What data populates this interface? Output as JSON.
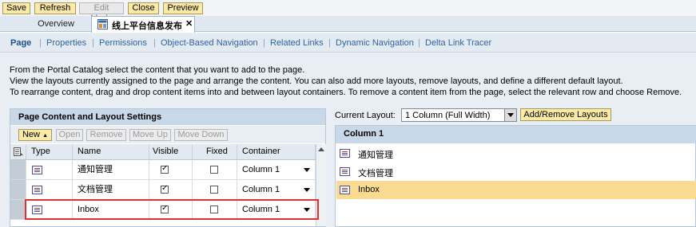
{
  "toolbar": {
    "buttons": [
      {
        "label": "Save",
        "enabled": true
      },
      {
        "label": "Refresh",
        "enabled": true
      },
      {
        "label": "Edit Mode",
        "enabled": false
      },
      {
        "label": "Close",
        "enabled": true
      },
      {
        "label": "Preview",
        "enabled": true
      }
    ]
  },
  "tabs": {
    "overview": "Overview",
    "active": "线上平台信息发布",
    "close_glyph": "✕"
  },
  "subnav": {
    "items": [
      "Page",
      "Properties",
      "Permissions",
      "Object-Based Navigation",
      "Related Links",
      "Dynamic Navigation",
      "Delta Link Tracer"
    ],
    "active_index": 0
  },
  "instructions": [
    "From the Portal Catalog select the content that you want to add to the page.",
    "View the layouts currently assigned to the page and arrange the content. You can also add more layouts, remove layouts, and define a different default layout.",
    "To rearrange content, drag and drop content items into and between layout containers. To remove a content item from the page, select the relevant row and choose Remove."
  ],
  "left_panel": {
    "title": "Page Content and Layout Settings",
    "buttons": [
      {
        "label": "New",
        "enabled": true
      },
      {
        "label": "Open",
        "enabled": false
      },
      {
        "label": "Remove",
        "enabled": false
      },
      {
        "label": "Move Up",
        "enabled": false
      },
      {
        "label": "Move Down",
        "enabled": false
      }
    ],
    "columns": [
      "Type",
      "Name",
      "Visible",
      "Fixed",
      "Container"
    ],
    "rows": [
      {
        "name": "通知管理",
        "visible": true,
        "fixed": false,
        "container": "Column 1"
      },
      {
        "name": "文档管理",
        "visible": true,
        "fixed": false,
        "container": "Column 1"
      },
      {
        "name": "Inbox",
        "visible": true,
        "fixed": false,
        "container": "Column 1"
      }
    ]
  },
  "right_panel": {
    "layout_label": "Current Layout:",
    "layout_value": "1 Column (Full Width)",
    "add_remove_label": "Add/Remove Layouts",
    "column_title": "Column 1",
    "items": [
      {
        "name": "通知管理",
        "highlighted": false
      },
      {
        "name": "文档管理",
        "highlighted": false
      },
      {
        "name": "Inbox",
        "highlighted": true
      }
    ]
  },
  "colors": {
    "button_bg": "#fbeaa8",
    "panel_header": "#c9d8e8",
    "highlight": "#fbdb91",
    "selection_outline": "#e03030",
    "link": "#2b65a6"
  }
}
